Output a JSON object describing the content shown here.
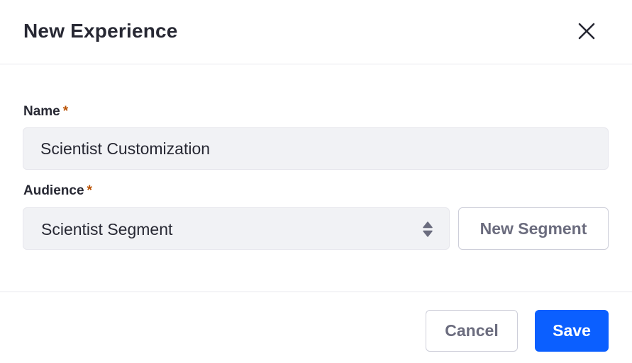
{
  "modal": {
    "title": "New Experience",
    "close_icon": "close-icon"
  },
  "form": {
    "name": {
      "label": "Name",
      "required_marker": "*",
      "value": "Scientist Customization"
    },
    "audience": {
      "label": "Audience",
      "required_marker": "*",
      "selected": "Scientist Segment",
      "icon": "select-arrows-icon"
    },
    "new_segment_label": "New Segment"
  },
  "footer": {
    "cancel_label": "Cancel",
    "save_label": "Save"
  },
  "colors": {
    "primary": "#0b5fff",
    "required": "#b95000",
    "input_background": "#f1f2f5",
    "secondary_text": "#6b6c7e"
  }
}
